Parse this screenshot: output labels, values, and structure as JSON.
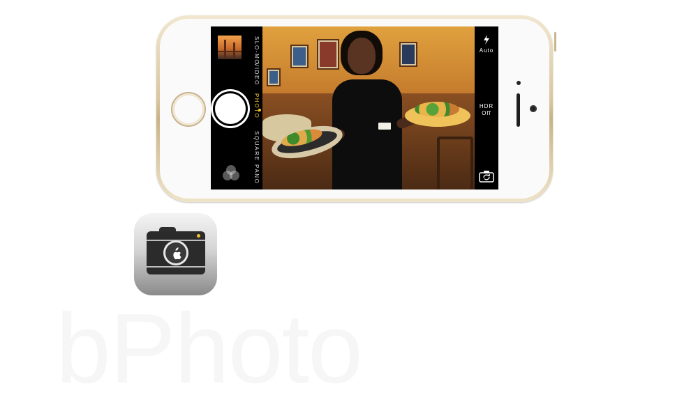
{
  "camera_ui": {
    "modes": [
      {
        "label": "SLO-MO",
        "active": false
      },
      {
        "label": "VIDEO",
        "active": false
      },
      {
        "label": "PHOTO",
        "active": true
      },
      {
        "label": "SQUARE",
        "active": false
      },
      {
        "label": "PANO",
        "active": false
      }
    ],
    "flash": {
      "icon": "flash-icon",
      "label": "Auto"
    },
    "hdr": {
      "line1": "HDR",
      "line2": "Off"
    },
    "icons": {
      "shutter": "shutter-button",
      "filters": "filters-icon",
      "switch_camera": "switch-camera-icon",
      "last_photo": "photo-thumbnail"
    },
    "active_color": "#f2c12e"
  },
  "app_icon": {
    "name": "camera-app-icon",
    "glyph": "apple-logo"
  },
  "watermark": {
    "text": "bPhoto"
  }
}
